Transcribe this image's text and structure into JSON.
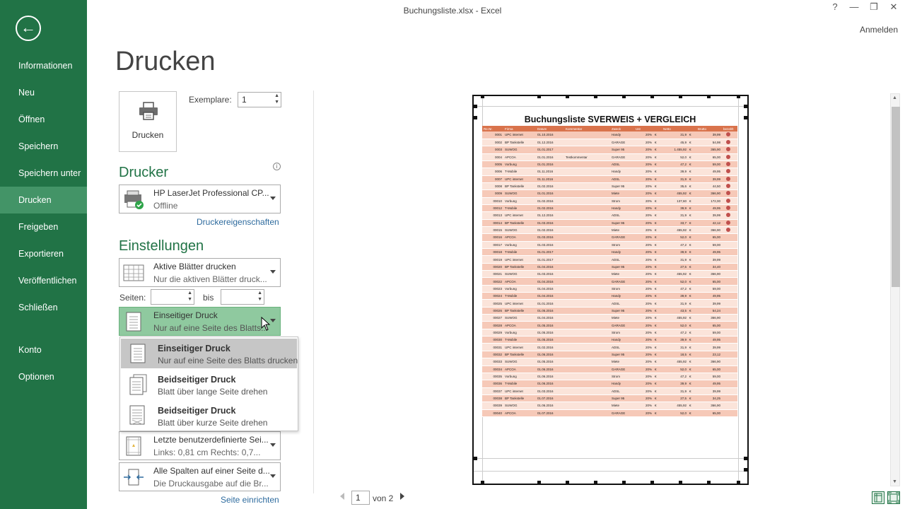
{
  "window": {
    "title": "Buchungsliste.xlsx - Excel",
    "help": "?",
    "minimize": "—",
    "restore": "❐",
    "close": "✕",
    "signin": "Anmelden"
  },
  "sidebar": {
    "back_icon": "←",
    "items": [
      {
        "label": "Informationen"
      },
      {
        "label": "Neu"
      },
      {
        "label": "Öffnen"
      },
      {
        "label": "Speichern"
      },
      {
        "label": "Speichern unter"
      },
      {
        "label": "Drucken",
        "active": true
      },
      {
        "label": "Freigeben"
      },
      {
        "label": "Exportieren"
      },
      {
        "label": "Veröffentlichen"
      },
      {
        "label": "Schließen"
      },
      {
        "label": "Konto"
      },
      {
        "label": "Optionen"
      }
    ]
  },
  "main": {
    "title": "Drucken",
    "print_button": "Drucken",
    "copies_label": "Exemplare:",
    "copies_value": "1",
    "printer_heading": "Drucker",
    "printer_name": "HP LaserJet Professional CP...",
    "printer_status": "Offline",
    "printer_props": "Druckereigenschaften",
    "settings_heading": "Einstellungen",
    "scope_title": "Aktive Blätter drucken",
    "scope_sub": "Nur die aktiven Blätter druck...",
    "pages_label": "Seiten:",
    "pages_to": "bis",
    "duplex_title": "Einseitiger Druck",
    "duplex_sub": "Nur auf eine Seite des Blatts...",
    "margins_title": "Letzte benutzerdefinierte Sei...",
    "margins_sub": "Links: 0,81 cm    Rechts: 0,7...",
    "scaling_title": "Alle Spalten auf einer Seite d...",
    "scaling_sub": "Die Druckausgabe auf die Br...",
    "page_setup": "Seite einrichten"
  },
  "duplex_options": [
    {
      "title": "Einseitiger Druck",
      "sub": "Nur auf eine Seite des Blatts drucken",
      "selected": true
    },
    {
      "title": "Beidseitiger Druck",
      "sub": "Blatt über lange Seite drehen"
    },
    {
      "title": "Beidseitiger Druck",
      "sub": "Blatt über kurze Seite drehen"
    }
  ],
  "preview": {
    "sheet_title": "Buchungsliste SVERWEIS + VERGLEICH",
    "columns": [
      "Re.Nr.",
      "Firma",
      "Datum",
      "Kommentar",
      "Zweck",
      "Ust",
      "",
      "Netto",
      "",
      "Brutto",
      "bezahlt"
    ],
    "rows": [
      [
        "0001",
        "UPC internet",
        "01.10.2016",
        "",
        "Handy",
        "20%",
        "€",
        "31,9",
        "€",
        "39,99",
        true
      ],
      [
        "0002",
        "BP Tankstelle",
        "01.12.2016",
        "",
        "GARAGE",
        "20%",
        "€",
        "45,9",
        "€",
        "54,98",
        true
      ],
      [
        "0003",
        "SUWOG",
        "01.01.2017",
        "",
        "Super 95",
        "20%",
        "€",
        "1.455,92",
        "€",
        "365,90",
        true
      ],
      [
        "0004",
        "APCOA",
        "01.01.2016",
        "Testkommentar",
        "GARAGE",
        "20%",
        "€",
        "52,0",
        "€",
        "65,00",
        true
      ],
      [
        "0005",
        "Vorbung",
        "01.01.2016",
        "",
        "ADSL",
        "20%",
        "€",
        "47,2",
        "€",
        "59,00",
        true
      ],
      [
        "0006",
        "T-Mobile",
        "01.11.2016",
        "",
        "Handy",
        "20%",
        "€",
        "39,9",
        "€",
        "49,95",
        true
      ],
      [
        "0007",
        "UPC internet",
        "01.11.2016",
        "",
        "ADSL",
        "20%",
        "€",
        "31,9",
        "€",
        "39,99",
        true
      ],
      [
        "0008",
        "BP Tankstelle",
        "01.02.2016",
        "",
        "Super 95",
        "20%",
        "€",
        "35,6",
        "€",
        "44,50",
        true
      ],
      [
        "0009",
        "SUWOG",
        "01.01.2016",
        "",
        "Miete",
        "20%",
        "€",
        "455,92",
        "€",
        "366,90",
        true
      ],
      [
        "00010",
        "Vorbung",
        "01.02.2016",
        "",
        "Strom",
        "20%",
        "€",
        "137,60",
        "€",
        "172,00",
        true
      ],
      [
        "00012",
        "T-Mobile",
        "01.02.2016",
        "",
        "Handy",
        "20%",
        "€",
        "39,9",
        "€",
        "49,95",
        true
      ],
      [
        "00013",
        "UPC internet",
        "01.12.2016",
        "",
        "ADSL",
        "20%",
        "€",
        "31,9",
        "€",
        "39,99",
        true
      ],
      [
        "00014",
        "BP Tankstelle",
        "01.03.2016",
        "",
        "Super 95",
        "20%",
        "€",
        "33,7",
        "€",
        "42,12",
        true
      ],
      [
        "00015",
        "SUWOG",
        "01.02.2016",
        "",
        "Miete",
        "20%",
        "€",
        "455,92",
        "€",
        "366,90",
        true
      ],
      [
        "00016",
        "APCOA",
        "01.03.2016",
        "",
        "GARAGE",
        "20%",
        "€",
        "52,0",
        "€",
        "65,00",
        false
      ],
      [
        "00017",
        "Vorbung",
        "01.03.2016",
        "",
        "Strom",
        "20%",
        "€",
        "47,2",
        "€",
        "59,00",
        false
      ],
      [
        "00018",
        "T-Mobile",
        "01.01.2017",
        "",
        "Handy",
        "20%",
        "€",
        "39,9",
        "€",
        "49,95",
        false
      ],
      [
        "00019",
        "UPC internet",
        "01.01.2017",
        "",
        "ADSL",
        "20%",
        "€",
        "31,9",
        "€",
        "39,99",
        false
      ],
      [
        "00020",
        "BP Tankstelle",
        "01.04.2016",
        "",
        "Super 95",
        "20%",
        "€",
        "27,5",
        "€",
        "34,40",
        false
      ],
      [
        "00021",
        "SUWOG",
        "01.03.2016",
        "",
        "Miete",
        "20%",
        "€",
        "455,92",
        "€",
        "366,90",
        false
      ],
      [
        "00022",
        "APCOA",
        "01.04.2016",
        "",
        "GARAGE",
        "20%",
        "€",
        "52,0",
        "€",
        "65,00",
        false
      ],
      [
        "00023",
        "Vorbung",
        "01.04.2016",
        "",
        "Strom",
        "20%",
        "€",
        "47,2",
        "€",
        "59,00",
        false
      ],
      [
        "00024",
        "T-Mobile",
        "01.04.2016",
        "",
        "Handy",
        "20%",
        "€",
        "39,9",
        "€",
        "49,95",
        false
      ],
      [
        "00025",
        "UPC internet",
        "01.01.2016",
        "",
        "ADSL",
        "20%",
        "€",
        "31,9",
        "€",
        "39,99",
        false
      ],
      [
        "00026",
        "BP Tankstelle",
        "01.05.2016",
        "",
        "Super 95",
        "20%",
        "€",
        "43,5",
        "€",
        "54,24",
        false
      ],
      [
        "00027",
        "SUWOG",
        "01.04.2016",
        "",
        "Miete",
        "20%",
        "€",
        "455,92",
        "€",
        "366,90",
        false
      ],
      [
        "00028",
        "APCOA",
        "01.05.2016",
        "",
        "GARAGE",
        "20%",
        "€",
        "52,0",
        "€",
        "65,00",
        false
      ],
      [
        "00029",
        "Vorbung",
        "01.05.2016",
        "",
        "Strom",
        "20%",
        "€",
        "47,2",
        "€",
        "59,00",
        false
      ],
      [
        "00030",
        "T-Mobile",
        "01.05.2016",
        "",
        "Handy",
        "20%",
        "€",
        "39,9",
        "€",
        "49,95",
        false
      ],
      [
        "00031",
        "UPC internet",
        "01.02.2016",
        "",
        "ADSL",
        "20%",
        "€",
        "31,9",
        "€",
        "39,99",
        false
      ],
      [
        "00032",
        "BP Tankstelle",
        "01.06.2016",
        "",
        "Super 95",
        "20%",
        "€",
        "18,5",
        "€",
        "23,12",
        false
      ],
      [
        "00033",
        "SUWOG",
        "01.05.2016",
        "",
        "Miete",
        "20%",
        "€",
        "455,92",
        "€",
        "366,90",
        false
      ],
      [
        "00034",
        "APCOA",
        "01.06.2016",
        "",
        "GARAGE",
        "20%",
        "€",
        "52,0",
        "€",
        "65,00",
        false
      ],
      [
        "00035",
        "Vorbung",
        "01.06.2016",
        "",
        "Strom",
        "20%",
        "€",
        "47,2",
        "€",
        "59,00",
        false
      ],
      [
        "00036",
        "T-Mobile",
        "01.06.2016",
        "",
        "Handy",
        "20%",
        "€",
        "39,9",
        "€",
        "49,95",
        false
      ],
      [
        "00037",
        "UPC internet",
        "01.03.2016",
        "",
        "ADSL",
        "20%",
        "€",
        "31,9",
        "€",
        "39,99",
        false
      ],
      [
        "00038",
        "BP Tankstelle",
        "01.07.2016",
        "",
        "Super 95",
        "20%",
        "€",
        "27,5",
        "€",
        "34,25",
        false
      ],
      [
        "00039",
        "SUWOG",
        "01.06.2016",
        "",
        "Miete",
        "20%",
        "€",
        "455,92",
        "€",
        "366,90",
        false
      ],
      [
        "00040",
        "APCOA",
        "01.07.2016",
        "",
        "GARAGE",
        "20%",
        "€",
        "52,0",
        "€",
        "65,00",
        false
      ]
    ],
    "page_current": "1",
    "page_total": "von 2"
  },
  "colors": {
    "accent": "#217346",
    "header": "#d9734c",
    "row_dark": "#f6c9b8",
    "row_light": "#fbe4da",
    "paid_dot": "#c0504d"
  }
}
